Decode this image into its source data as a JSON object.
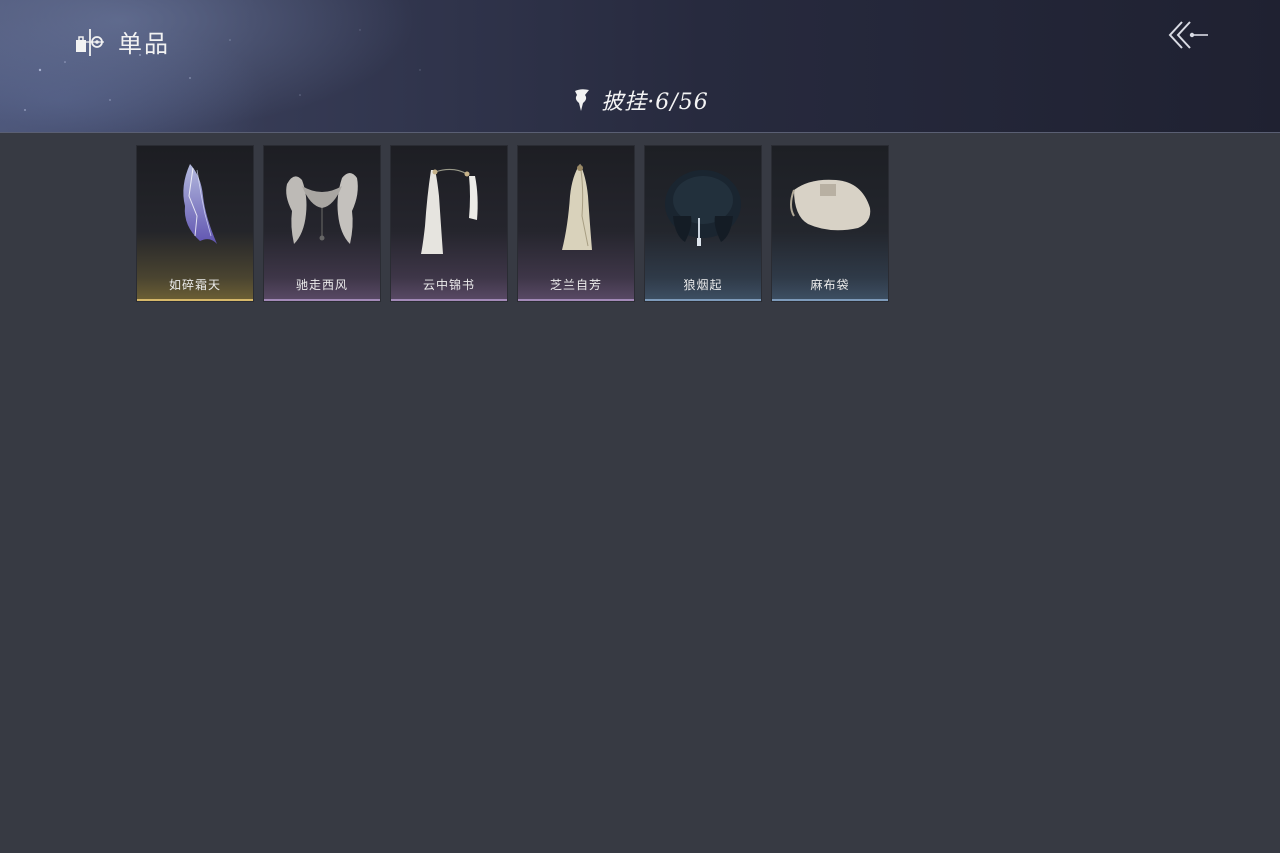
{
  "header": {
    "title": "单品",
    "title_icon": "wardrobe-emblem-icon",
    "back_icon": "back-arrow-icon",
    "category": {
      "label": "披挂·6/56",
      "icon": "cloak-icon"
    }
  },
  "items": [
    {
      "name": "如碎霜天",
      "rarity": "gold",
      "image": "lightning-cape"
    },
    {
      "name": "驰走西风",
      "rarity": "purple",
      "image": "fur-shawl"
    },
    {
      "name": "云中锦书",
      "rarity": "purple",
      "image": "white-robe-banners"
    },
    {
      "name": "芝兰自芳",
      "rarity": "purple",
      "image": "cream-cloak"
    },
    {
      "name": "狼烟起",
      "rarity": "blue",
      "image": "dark-fur-mantle"
    },
    {
      "name": "麻布袋",
      "rarity": "blue",
      "image": "linen-sack"
    }
  ],
  "colors": {
    "background": "#373a43",
    "gold": "#d6b86a",
    "purple": "#a38ab8",
    "blue": "#7e9bbb"
  }
}
